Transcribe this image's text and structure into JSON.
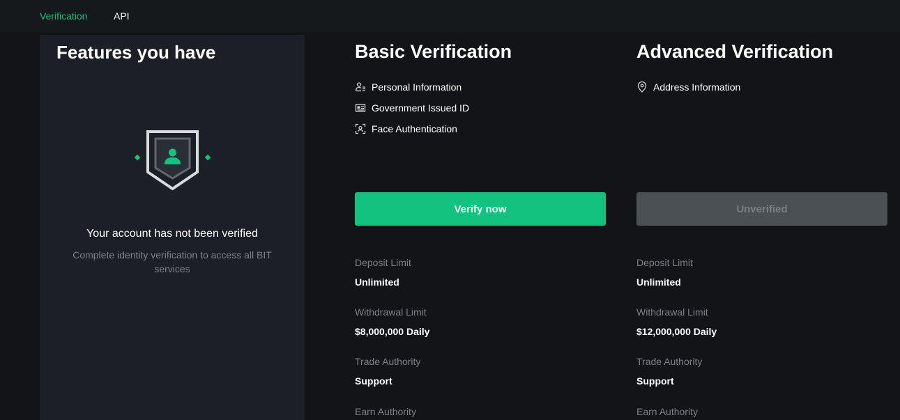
{
  "nav": {
    "tabs": [
      {
        "label": "Verification",
        "active": true
      },
      {
        "label": "API",
        "active": false
      }
    ]
  },
  "features_panel": {
    "title": "Features you have",
    "status_title": "Your account has not been verified",
    "status_description": "Complete identity verification to access all BIT services",
    "icon": "shield-user-icon"
  },
  "basic": {
    "title": "Basic Verification",
    "features": [
      {
        "label": "Personal Information",
        "icon": "person-list-icon"
      },
      {
        "label": "Government Issued ID",
        "icon": "id-card-icon"
      },
      {
        "label": "Face Authentication",
        "icon": "face-scan-icon"
      }
    ],
    "button_label": "Verify now",
    "limits": [
      {
        "label": "Deposit Limit",
        "value": "Unlimited"
      },
      {
        "label": "Withdrawal Limit",
        "value": "$8,000,000 Daily"
      },
      {
        "label": "Trade Authority",
        "value": "Support"
      },
      {
        "label": "Earn Authority",
        "value": ""
      }
    ]
  },
  "advanced": {
    "title": "Advanced Verification",
    "features": [
      {
        "label": "Address Information",
        "icon": "location-pin-icon"
      }
    ],
    "button_label": "Unverified",
    "limits": [
      {
        "label": "Deposit Limit",
        "value": "Unlimited"
      },
      {
        "label": "Withdrawal Limit",
        "value": "$12,000,000 Daily"
      },
      {
        "label": "Trade Authority",
        "value": "Support"
      },
      {
        "label": "Earn Authority",
        "value": ""
      }
    ]
  },
  "colors": {
    "accent": "#12c27e",
    "disabled_button": "#4b5054",
    "panel_bg": "#1c2026",
    "page_bg": "#121417"
  }
}
